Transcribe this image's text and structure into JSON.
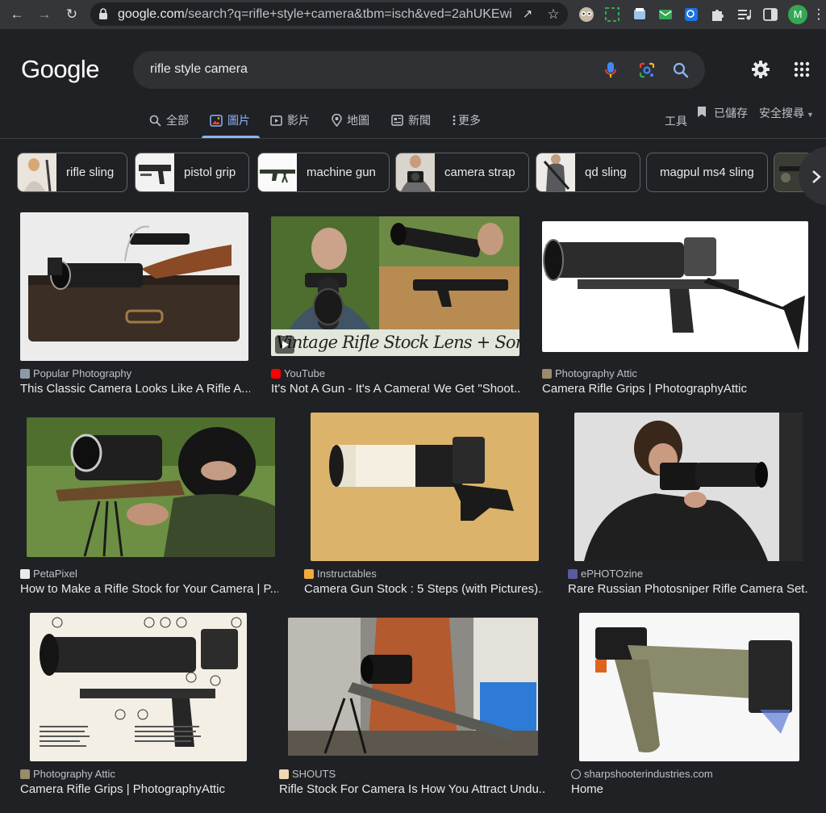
{
  "browser": {
    "url_domain": "google.com",
    "url_rest": "/search?q=rifle+style+camera&tbm=isch&ved=2ahUKEwi...",
    "profile_initial": "M"
  },
  "google": {
    "logo": "Google",
    "query": "rifle style camera"
  },
  "tabs": [
    {
      "label": "全部",
      "icon": "search-icon"
    },
    {
      "label": "圖片",
      "icon": "image-icon"
    },
    {
      "label": "影片",
      "icon": "video-icon"
    },
    {
      "label": "地圖",
      "icon": "map-pin-icon"
    },
    {
      "label": "新聞",
      "icon": "news-icon"
    },
    {
      "label": "更多",
      "icon": "more-dots-icon"
    }
  ],
  "tools": {
    "tools_label": "工具",
    "saved_label": "已儲存",
    "safesearch_label": "安全搜尋"
  },
  "chips": [
    {
      "label": "rifle sling"
    },
    {
      "label": "pistol grip"
    },
    {
      "label": "machine gun"
    },
    {
      "label": "camera strap"
    },
    {
      "label": "qd sling"
    },
    {
      "label": "magpul ms4 sling"
    }
  ],
  "results": [
    {
      "source": "Popular Photography",
      "title": "This Classic Camera Looks Like A Rifle A..."
    },
    {
      "source": "YouTube",
      "title": "It's Not A Gun - It's A Camera! We Get \"Shoot...",
      "overlay_text": "Vintage Rifle Stock Lens + Sony Camera"
    },
    {
      "source": "Photography Attic",
      "title": "Camera Rifle Grips | PhotographyAttic"
    },
    {
      "source": "PetaPixel",
      "title": "How to Make a Rifle Stock for Your Camera | P..."
    },
    {
      "source": "Instructables",
      "title": "Camera Gun Stock : 5 Steps (with Pictures)..."
    },
    {
      "source": "ePHOTOzine",
      "title": "Rare Russian Photosniper Rifle Camera Set..."
    },
    {
      "source": "Photography Attic",
      "title": "Camera Rifle Grips | PhotographyAttic"
    },
    {
      "source": "SHOUTS",
      "title": "Rifle Stock For Camera Is How You Attract Undu..."
    },
    {
      "source": "sharpshooterindustries.com",
      "title": "Home"
    }
  ],
  "colors": {
    "background": "#202124",
    "accent_blue": "#8ab4f8",
    "text": "#e8eaed",
    "muted_text": "#bdc1c6"
  }
}
